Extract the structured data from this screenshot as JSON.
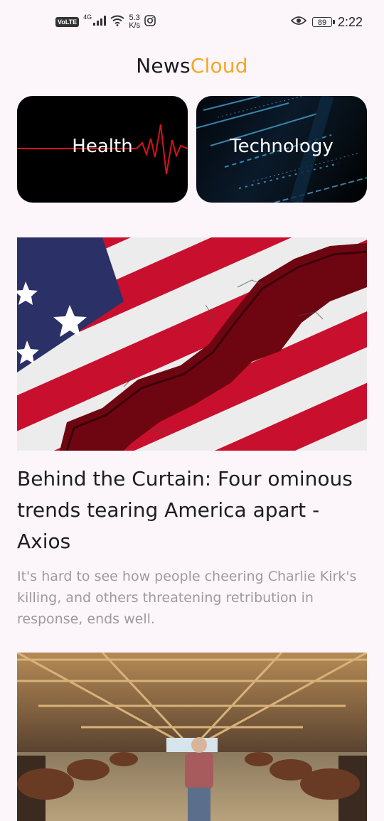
{
  "status_bar": {
    "volte": "VoLTE",
    "network": "4G",
    "speed_value": "5.3",
    "speed_unit": "K/s",
    "battery": "89",
    "time": "2:22"
  },
  "app": {
    "title_part1": "News",
    "title_part2": "Cloud",
    "accent_color": "#f5a623"
  },
  "categories": [
    {
      "label": "Health",
      "icon": "heartbeat-line"
    },
    {
      "label": "Technology",
      "icon": "data-streams"
    }
  ],
  "articles": [
    {
      "headline": "Behind the Curtain: Four ominous trends tearing America apart - Axios",
      "summary": "It's hard to see how people cheering Charlie Kirk's killing, and others threatening retribution in response, ends well.",
      "image": "cracked-american-flag"
    },
    {
      "headline": "",
      "summary": "",
      "image": "farmer-in-cattle-barn"
    }
  ]
}
